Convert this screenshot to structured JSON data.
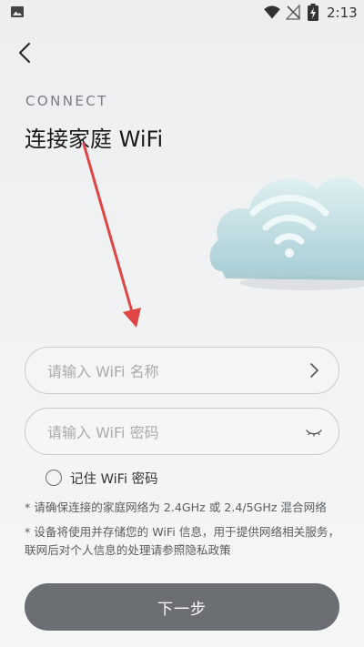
{
  "status_bar": {
    "time": "2:13",
    "icons": [
      "image-icon",
      "wifi-icon",
      "signal-off-icon",
      "battery-charging-icon"
    ]
  },
  "header": {
    "back_icon": "chevron-left-icon",
    "eyebrow": "CONNECT",
    "title": "连接家庭 WiFi"
  },
  "form": {
    "wifi_name": {
      "value": "",
      "placeholder": "请输入 WiFi 名称",
      "trailing_icon": "chevron-right-icon"
    },
    "wifi_password": {
      "value": "",
      "placeholder": "请输入 WiFi 密码",
      "trailing_icon": "eye-closed-icon"
    },
    "remember": {
      "label": "记住 WiFi 密码",
      "checked": false
    }
  },
  "notes": [
    "* 请确保连接的家庭网络为 2.4GHz 或 2.4/5GHz 混合网络",
    "* 设备将使用并存储您的 WiFi 信息，用于提供网络相关服务，联网后对个人信息的处理请参照隐私政策"
  ],
  "actions": {
    "next_label": "下一步"
  },
  "colors": {
    "arrow": "#e04545",
    "button_bg": "#6b6e72",
    "cloud": "#c6e1e6"
  }
}
